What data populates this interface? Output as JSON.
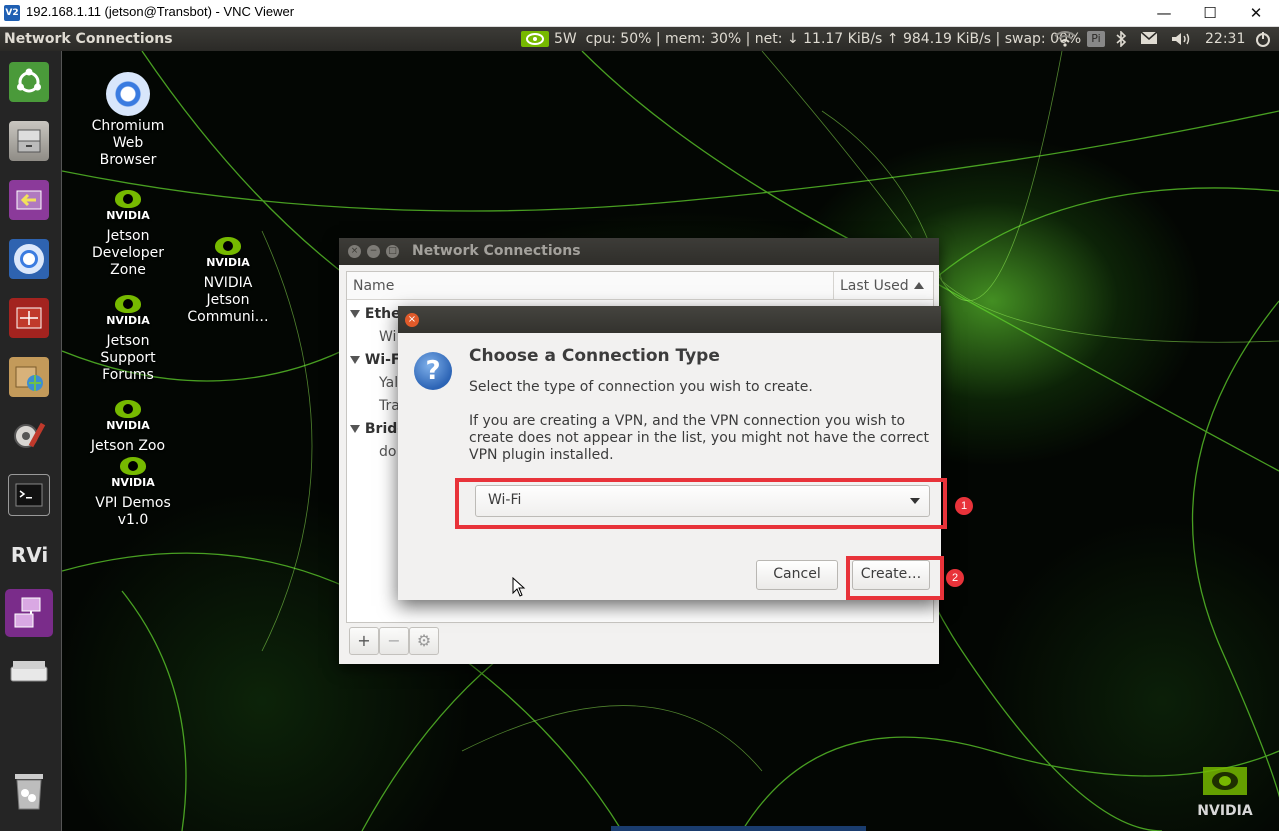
{
  "vnc": {
    "logo": "V2",
    "title": "192.168.1.11 (jetson@Transbot) - VNC Viewer",
    "minimize": "—",
    "maximize": "☐",
    "close": "✕"
  },
  "panel": {
    "app_title": "Network Connections",
    "power": "5W",
    "stats": "cpu: 50% | mem: 30% | net: ↓ 11.17 KiB/s ↑ 984.19 KiB/s | swap: 00%",
    "pi_badge": "Pi",
    "clock": "22:31"
  },
  "desktop_icons": {
    "chromium": "Chromium Web Browser",
    "jetson_dev_zone": "Jetson Developer Zone",
    "jetson_community": "NVIDIA Jetson Communi…",
    "jetson_forums": "Jetson Support Forums",
    "jetson_zoo": "Jetson Zoo",
    "vpi_demos": "VPI Demos v1.0",
    "nvidia_logo_text": "NVIDIA"
  },
  "nc_window": {
    "title": "Network Connections",
    "col_name": "Name",
    "col_last_used": "Last Used",
    "rows": [
      {
        "label": "Ethe",
        "type": "group"
      },
      {
        "label": "Wi",
        "type": "item"
      },
      {
        "label": "Wi-Fi",
        "type": "group"
      },
      {
        "label": "Yal",
        "type": "item"
      },
      {
        "label": "Tra",
        "type": "item"
      },
      {
        "label": "Bridg",
        "type": "group"
      },
      {
        "label": "do",
        "type": "item"
      }
    ],
    "add": "+",
    "remove": "−",
    "settings": "⚙"
  },
  "dialog": {
    "close": "×",
    "heading": "Choose a Connection Type",
    "subtitle": "Select the type of connection you wish to create.",
    "info": "If you are creating a VPN, and the VPN connection you wish to create does not appear in the list, you might not have the correct VPN plugin installed.",
    "selected_type": "Wi-Fi",
    "cancel": "Cancel",
    "create": "Create…"
  },
  "annotations": {
    "step1": "1",
    "step2": "2"
  },
  "colors": {
    "accent_red": "#e8333a",
    "nvidia_green": "#76b900"
  }
}
